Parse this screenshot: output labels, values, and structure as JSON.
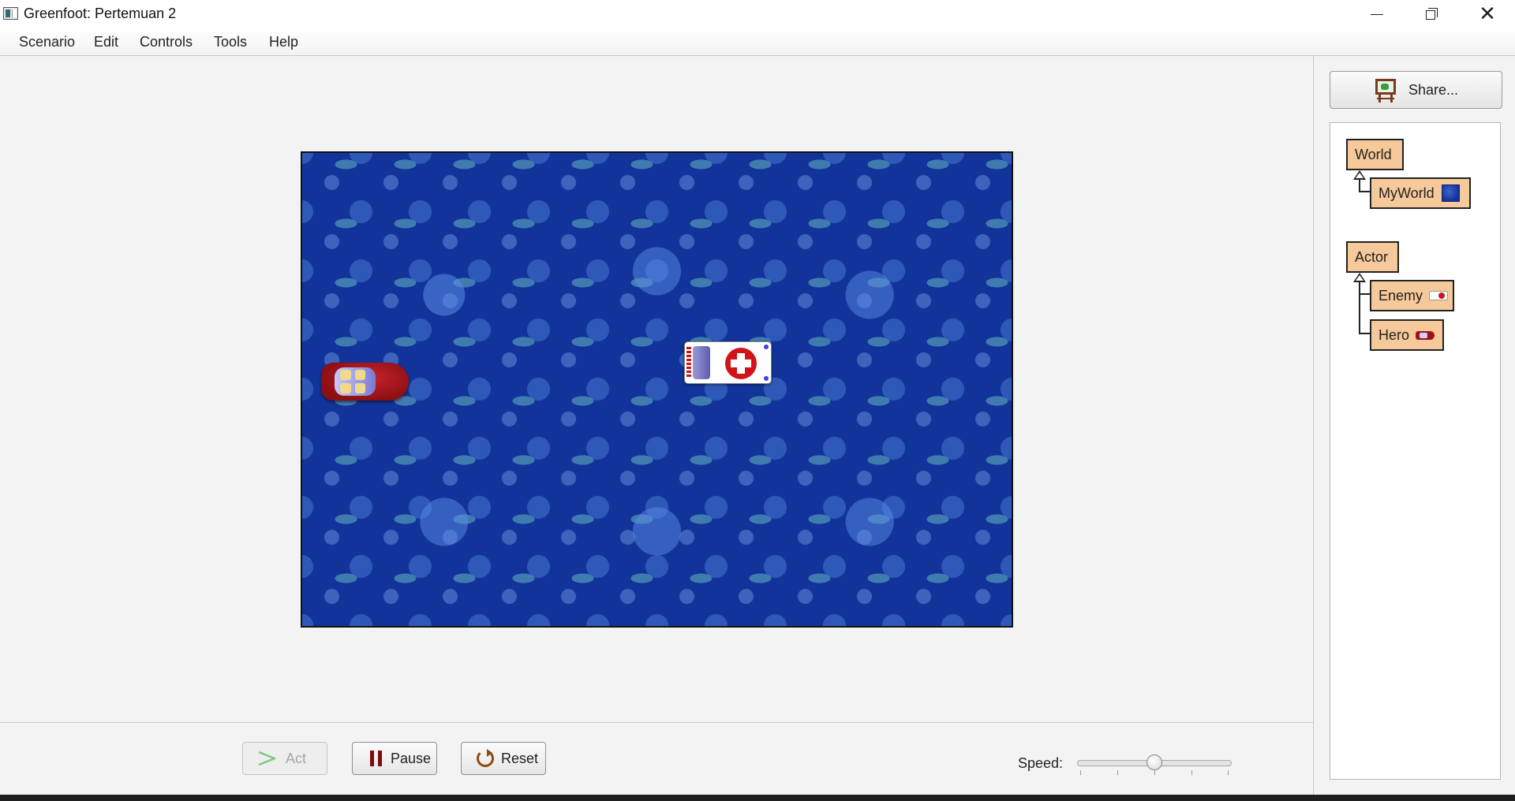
{
  "window": {
    "title": "Greenfoot: Pertemuan 2",
    "icon": "greenfoot-app-icon"
  },
  "menu": {
    "items": [
      {
        "label": "Scenario"
      },
      {
        "label": "Edit"
      },
      {
        "label": "Controls"
      },
      {
        "label": "Tools"
      },
      {
        "label": "Help"
      }
    ]
  },
  "world": {
    "background": "bubble-water-texture",
    "background_color": "#12339a",
    "actors": [
      {
        "class": "Hero",
        "icon": "red-car-icon"
      },
      {
        "class": "Enemy",
        "icon": "ambulance-icon"
      }
    ]
  },
  "controls": {
    "act_label": "Act",
    "act_enabled": false,
    "pause_label": "Pause",
    "reset_label": "Reset",
    "speed_label": "Speed:",
    "speed_fraction": 0.5
  },
  "sidebar": {
    "share_label": "Share...",
    "classes": {
      "world_root": "World",
      "world_sub": "MyWorld",
      "actor_root": "Actor",
      "actor_subs": [
        "Enemy",
        "Hero"
      ]
    }
  },
  "colors": {
    "class_box": "#f5c999",
    "accent_pause": "#7a0d0d",
    "act_arrow": "#4caf50"
  }
}
